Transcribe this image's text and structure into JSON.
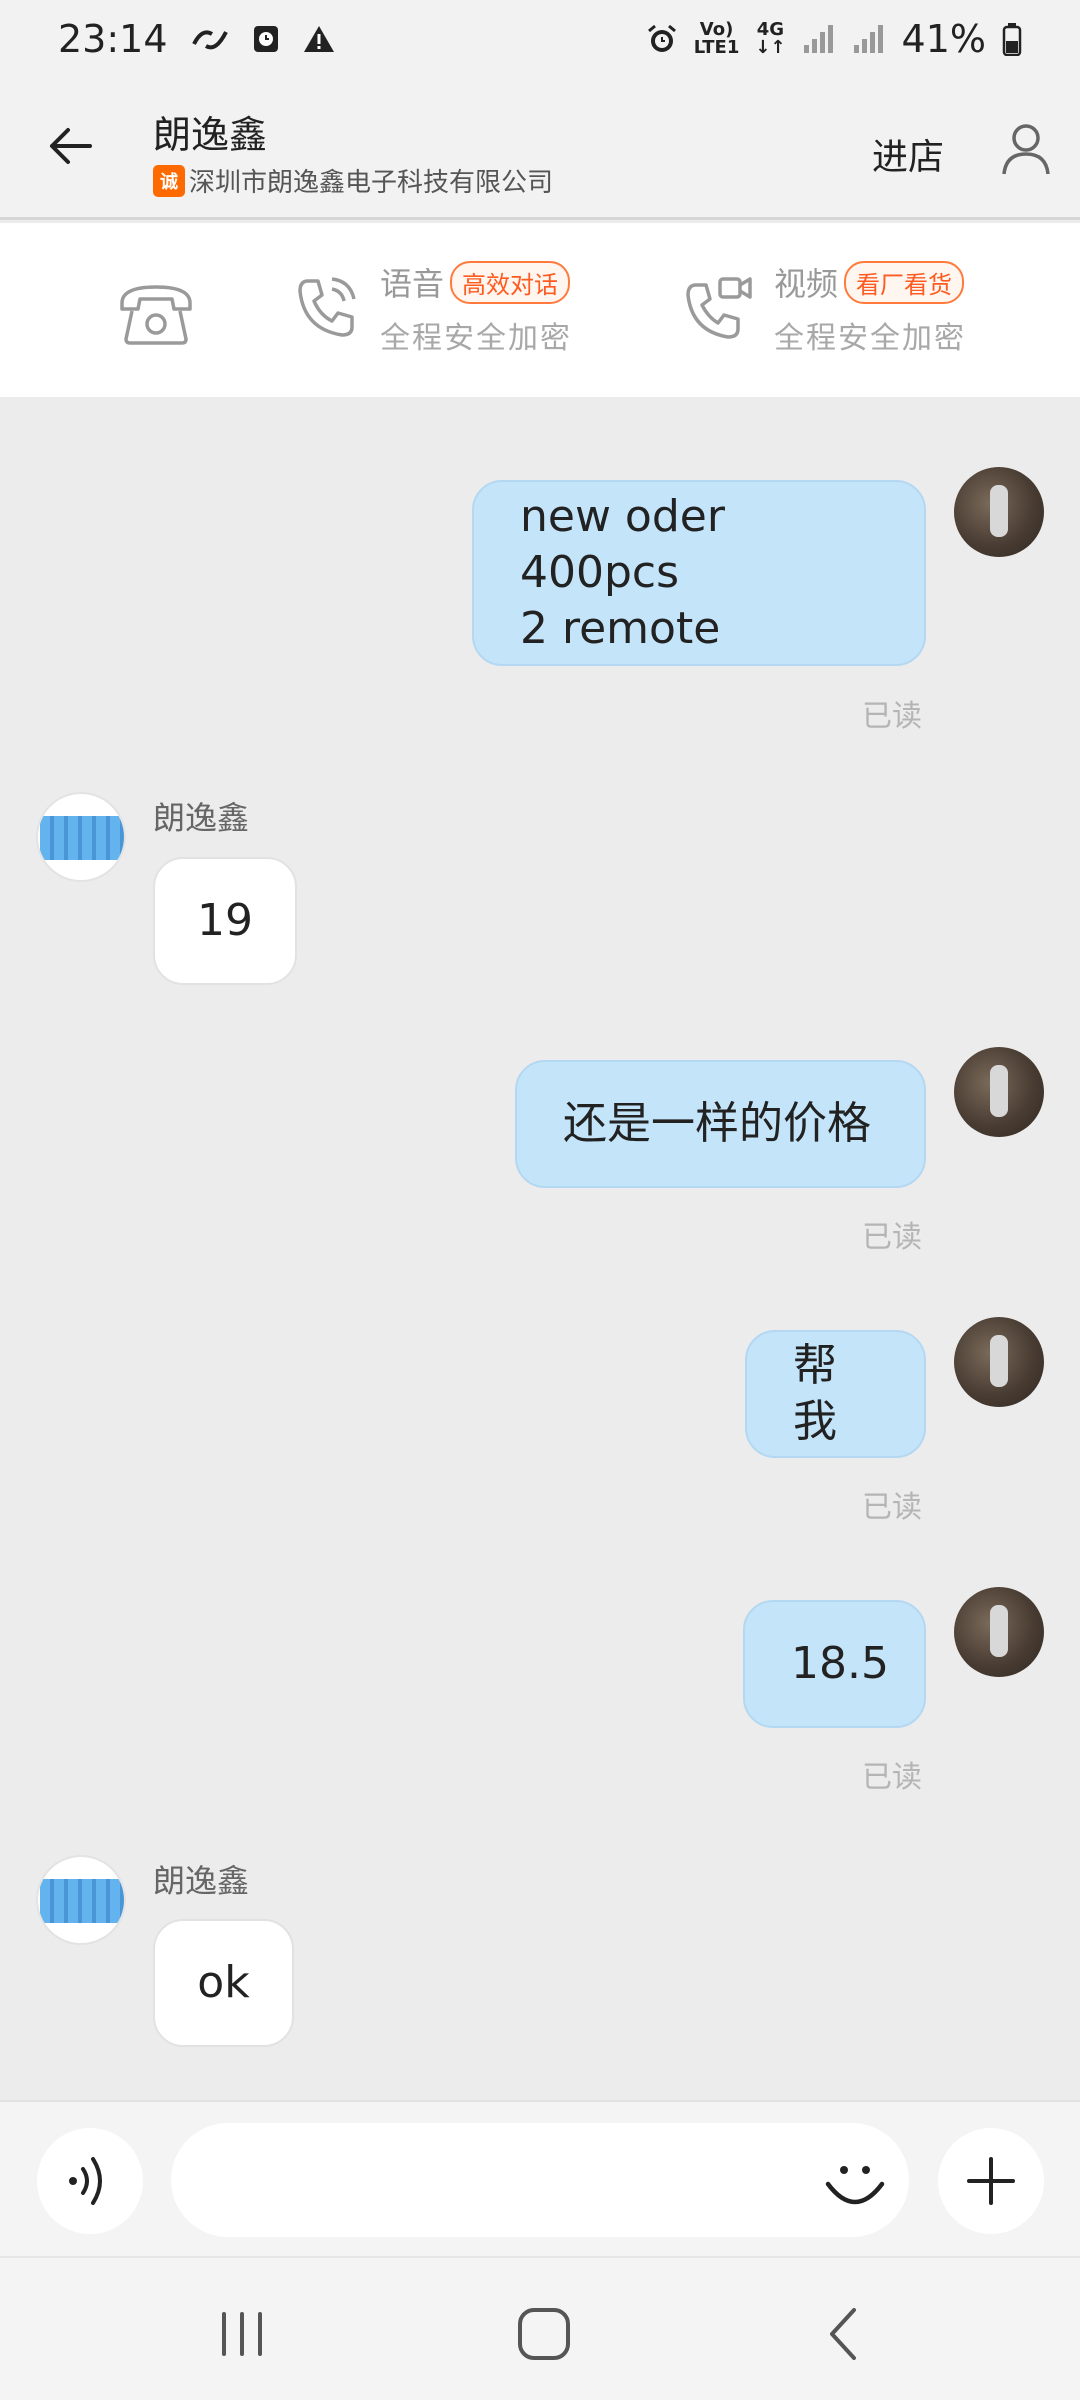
{
  "status_bar": {
    "time": "23:14",
    "network_top": "Vo)",
    "network_bottom": "LTE1",
    "signal_type": "4G",
    "battery": "41%",
    "icons": [
      "link-icon",
      "clock-app-icon",
      "warning-icon",
      "alarm-icon",
      "lte-icon",
      "data-arrows-icon",
      "signal-icon",
      "signal-icon",
      "battery-icon"
    ]
  },
  "header": {
    "title": "朗逸鑫",
    "badge": "诚",
    "subtitle": "深圳市朗逸鑫电子科技有限公司",
    "enter_store": "进店"
  },
  "call_bar": {
    "voice_label": "语音",
    "voice_tag": "高效对话",
    "voice_sub": "全程安全加密",
    "video_label": "视频",
    "video_tag": "看厂看货",
    "video_sub": "全程安全加密"
  },
  "messages": [
    {
      "direction": "out",
      "text_line1": "new oder 400pcs",
      "text_line2": "2 remote",
      "read": "已读"
    },
    {
      "direction": "in",
      "sender": "朗逸鑫",
      "text": "19"
    },
    {
      "direction": "out",
      "text": "还是一样的价格",
      "read": "已读"
    },
    {
      "direction": "out",
      "text": "帮我",
      "read": "已读"
    },
    {
      "direction": "out",
      "text": "18.5",
      "read": "已读"
    },
    {
      "direction": "in",
      "sender": "朗逸鑫",
      "text": "ok"
    }
  ],
  "input": {
    "value": "",
    "placeholder": ""
  },
  "colors": {
    "accent": "#ff6a00",
    "outgoing_bubble": "#c4e4fa",
    "incoming_bubble": "#ffffff",
    "background": "#ececec"
  }
}
